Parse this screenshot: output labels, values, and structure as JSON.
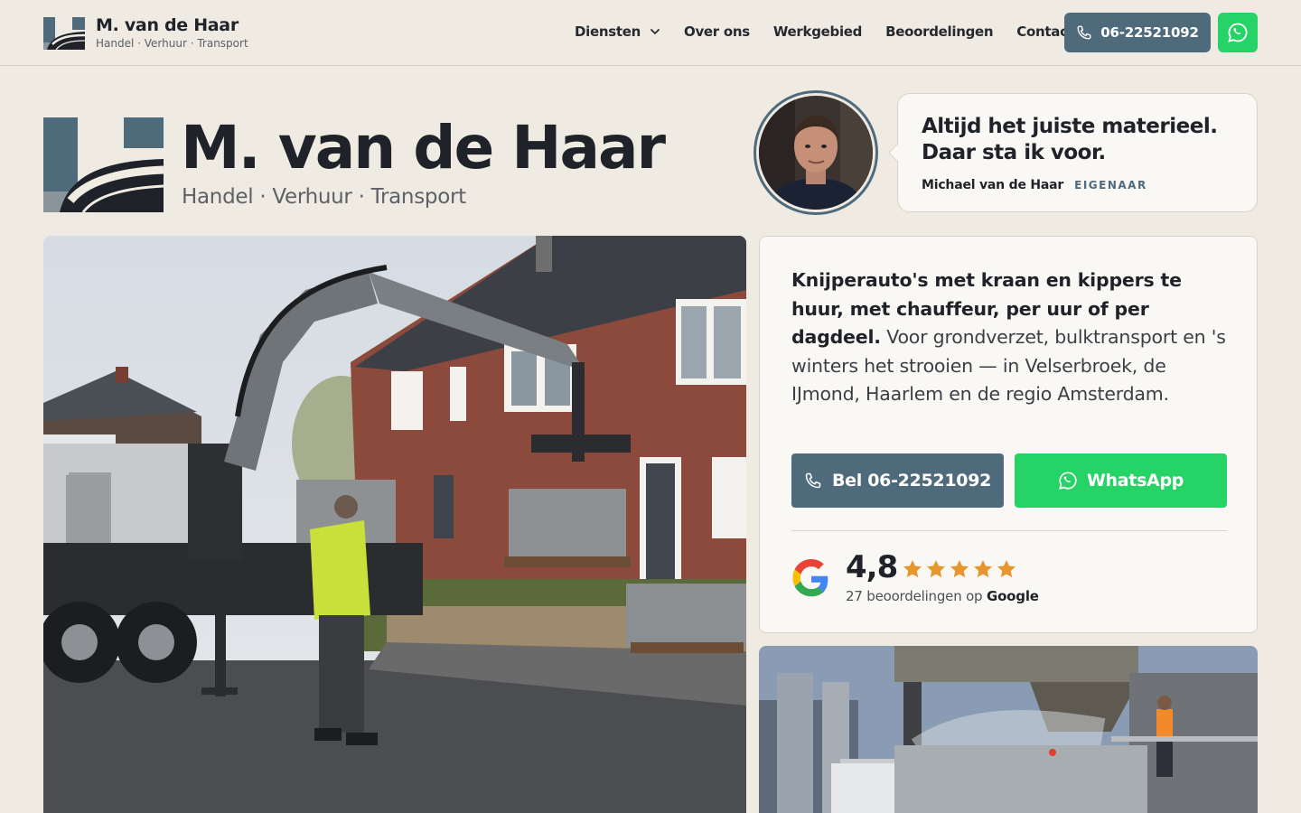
{
  "header": {
    "brand_name": "M. van de Haar",
    "brand_tagline": "Handel · Verhuur · Transport",
    "nav": [
      {
        "label": "Diensten",
        "dropdown": true
      },
      {
        "label": "Over ons"
      },
      {
        "label": "Werkgebied"
      },
      {
        "label": "Beoordelingen"
      },
      {
        "label": "Contact"
      }
    ],
    "phone_label": "06-22521092",
    "whatsapp_icon": "whatsapp-icon"
  },
  "hero": {
    "title": "M. van de Haar",
    "subtitle": "Handel · Verhuur · Transport"
  },
  "quote": {
    "text": "Altijd het juiste materieel. Daar sta ik voor.",
    "name": "Michael van de Haar",
    "role": "EIGENAAR"
  },
  "intro": {
    "bold": "Knijperauto's met kraan en kippers te huur, met chauffeur, per uur of per dagdeel.",
    "rest": " Voor grondverzet, bulktransport en 's winters het strooien — in Velserbroek, de IJmond, Haarlem en de regio Amsterdam."
  },
  "cta": {
    "call_label": "Bel 06-22521092",
    "whatsapp_label": "WhatsApp"
  },
  "rating": {
    "score": "4,8",
    "stars": 5,
    "reviews_prefix": "27 beoordelingen op ",
    "reviews_source": "Google"
  },
  "colors": {
    "accent": "#4f6b7b",
    "whatsapp": "#25d366",
    "star": "#e8952c",
    "background": "#efebe3"
  }
}
